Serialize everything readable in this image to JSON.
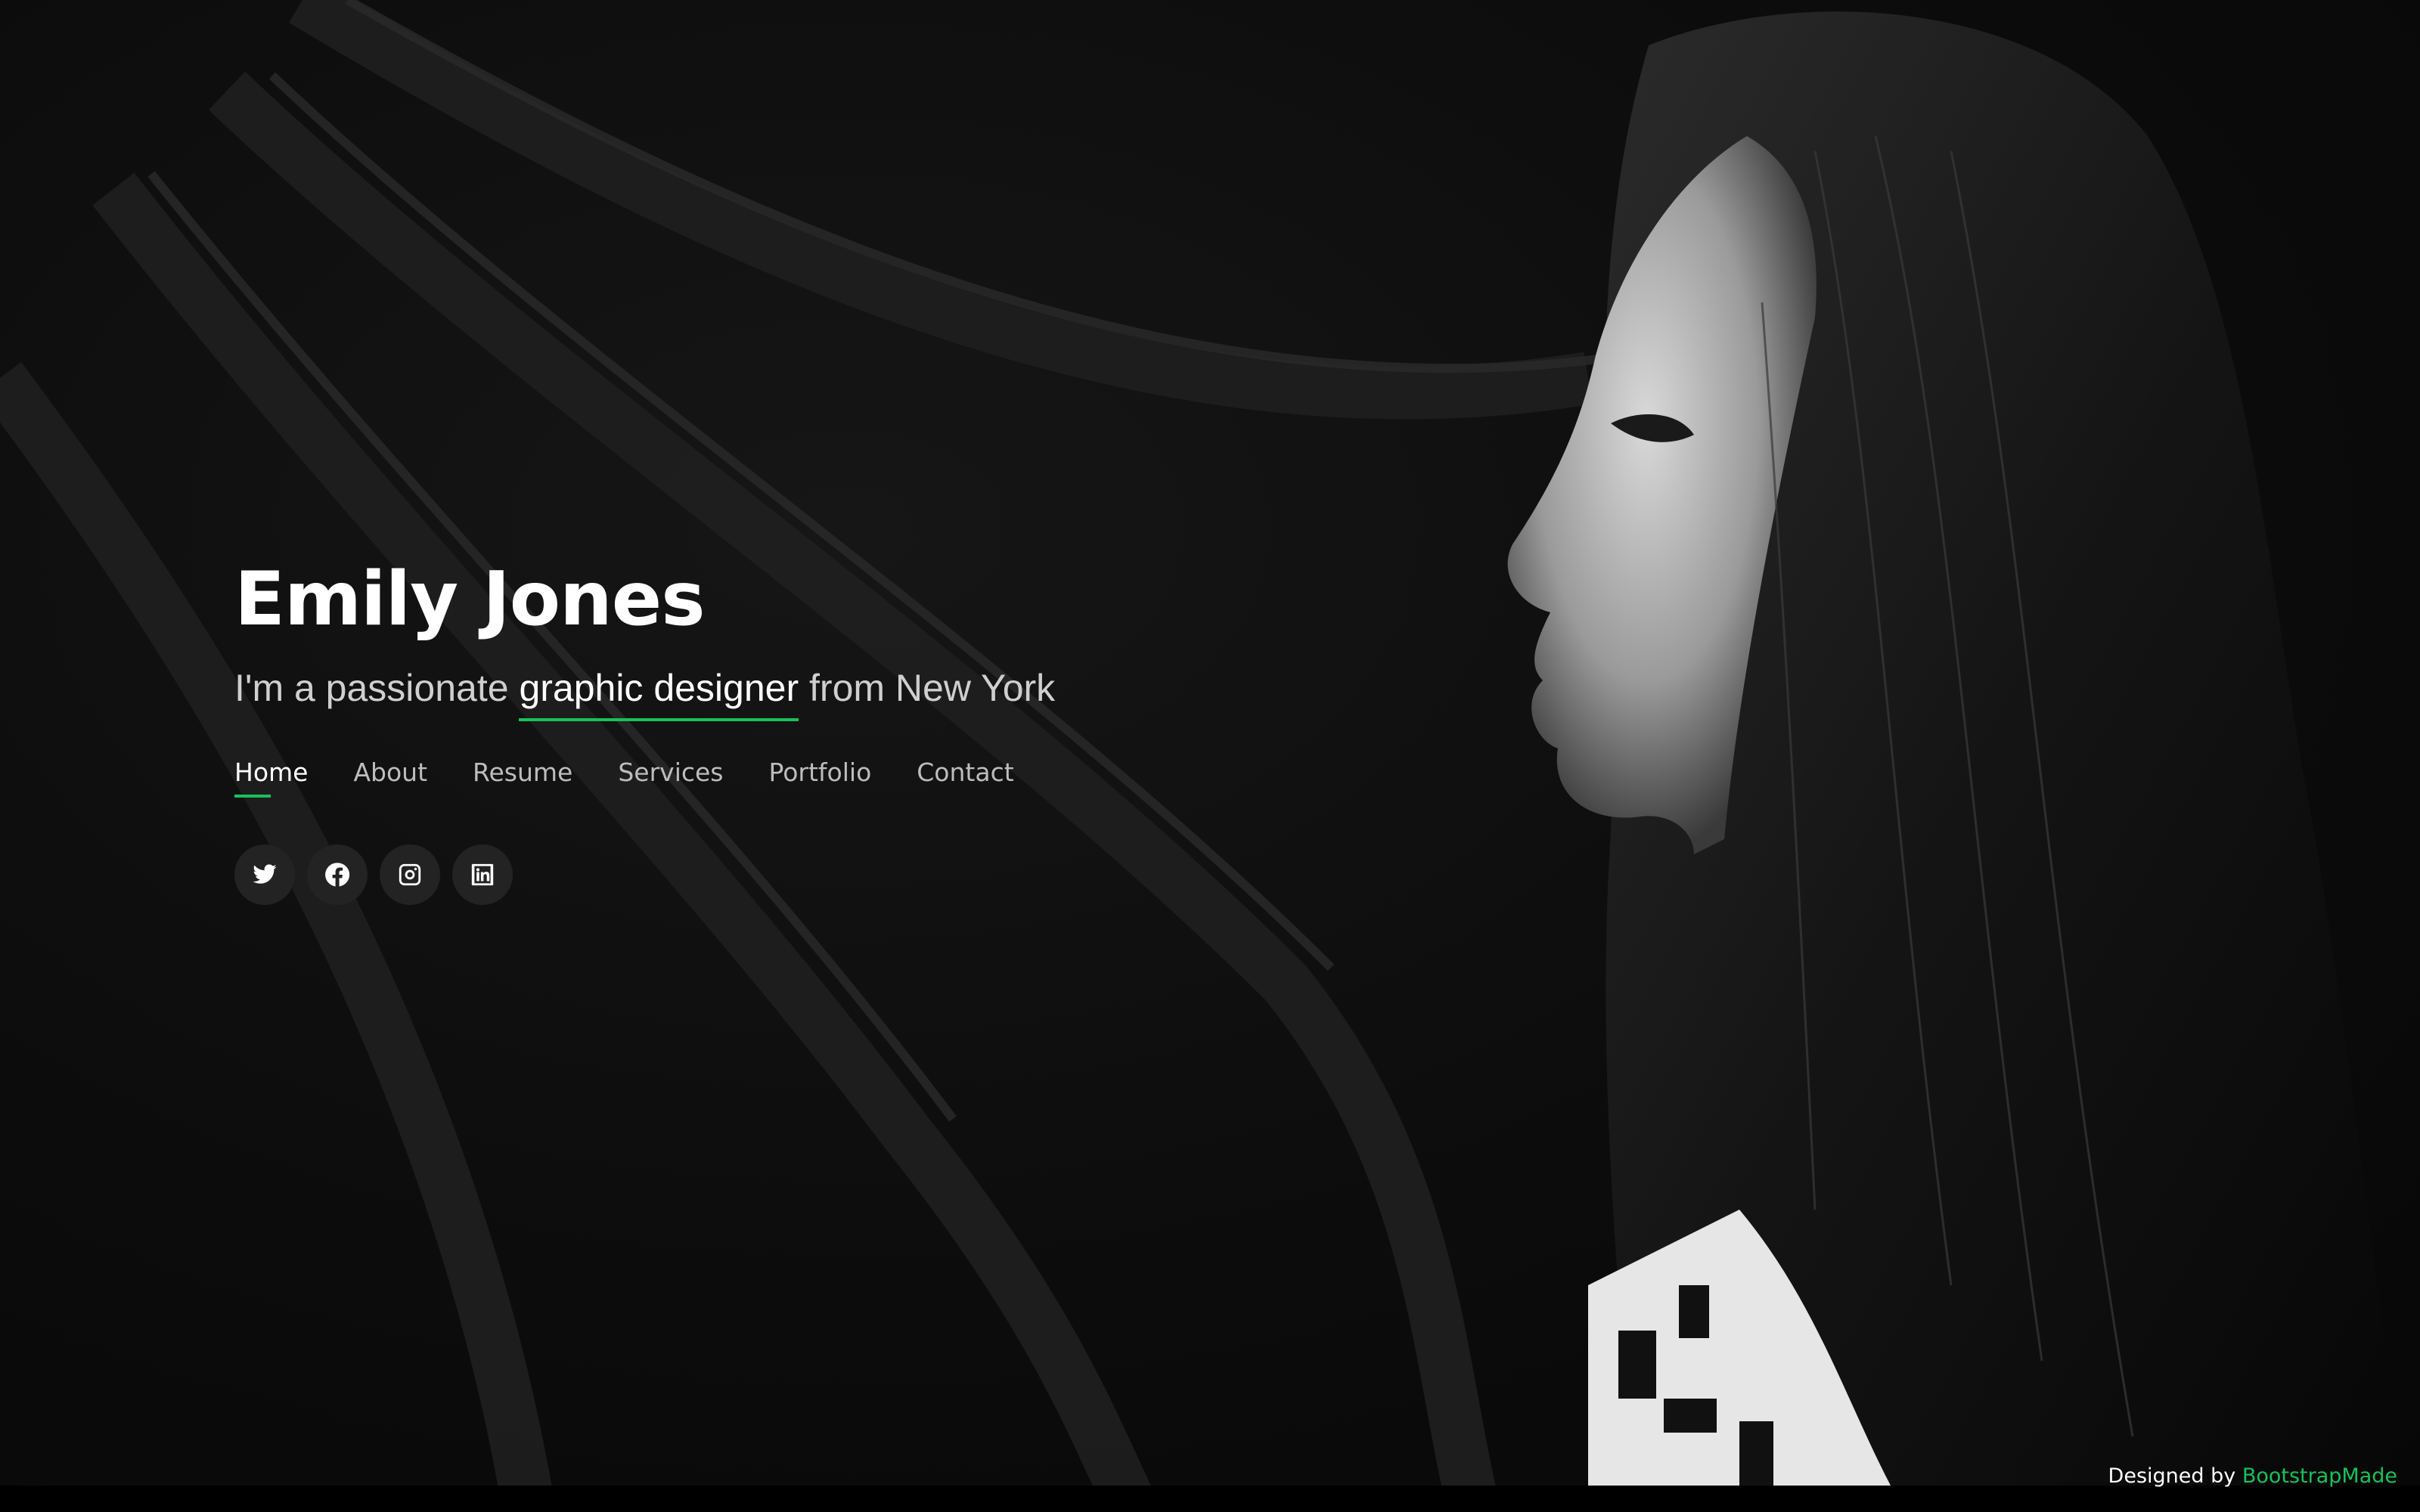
{
  "hero": {
    "name": "Emily Jones",
    "tagline_prefix": "I'm a passionate",
    "tagline_highlight": "graphic designer",
    "tagline_suffix": "from New York"
  },
  "nav": {
    "items": [
      {
        "label": "Home",
        "active": true
      },
      {
        "label": "About",
        "active": false
      },
      {
        "label": "Resume",
        "active": false
      },
      {
        "label": "Services",
        "active": false
      },
      {
        "label": "Portfolio",
        "active": false
      },
      {
        "label": "Contact",
        "active": false
      }
    ]
  },
  "social": {
    "icons": [
      "twitter-icon",
      "facebook-icon",
      "instagram-icon",
      "linkedin-icon"
    ]
  },
  "footer": {
    "credits_prefix": "Designed by",
    "credits_link": "BootstrapMade"
  },
  "colors": {
    "accent": "#19c15a",
    "background": "#0b0b0b",
    "social_button_bg": "#232323"
  }
}
